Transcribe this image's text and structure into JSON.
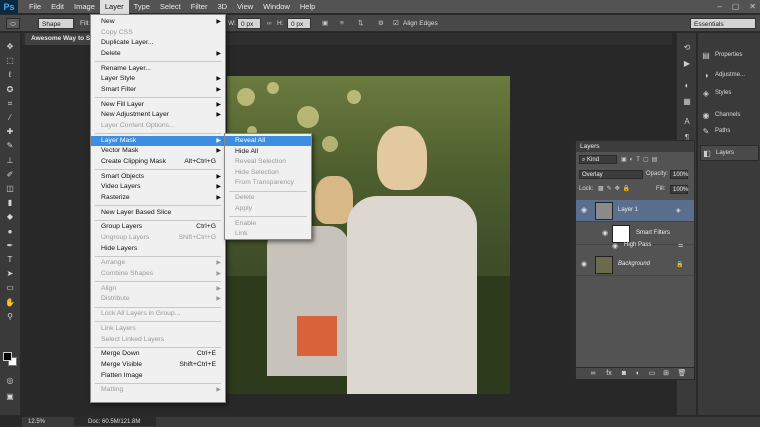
{
  "app": {
    "logo": "Ps",
    "window_controls": [
      "–",
      "▢",
      "✕"
    ]
  },
  "menubar": {
    "items": [
      "File",
      "Edit",
      "Image",
      "Layer",
      "Type",
      "Select",
      "Filter",
      "3D",
      "View",
      "Window",
      "Help"
    ],
    "active": "Layer"
  },
  "options": {
    "shape_label": "Shape",
    "fill_label": "Fill:",
    "w_label": "W:",
    "w_value": "0 px",
    "h_label": "H:",
    "h_value": "0 px",
    "align_edges": "Align Edges",
    "workspace": "Essentials"
  },
  "document": {
    "tab_title": "Awesome Way to Sh"
  },
  "status": {
    "zoom": "12.5%",
    "doc_size": "Doc: 60.5M/121.8M"
  },
  "layer_menu": {
    "items": [
      {
        "label": "New",
        "arrow": true
      },
      {
        "label": "Copy CSS",
        "disabled": true
      },
      {
        "label": "Duplicate Layer..."
      },
      {
        "label": "Delete",
        "arrow": true
      },
      {
        "label": "Rename Layer..."
      },
      {
        "label": "Layer Style",
        "arrow": true
      },
      {
        "label": "Smart Filter",
        "arrow": true
      },
      {
        "label": "New Fill Layer",
        "arrow": true
      },
      {
        "label": "New Adjustment Layer",
        "arrow": true
      },
      {
        "label": "Layer Content Options...",
        "disabled": true
      },
      {
        "label": "Layer Mask",
        "arrow": true,
        "highlight": true
      },
      {
        "label": "Vector Mask",
        "arrow": true
      },
      {
        "label": "Create Clipping Mask",
        "shortcut": "Alt+Ctrl+G"
      },
      {
        "label": "Smart Objects",
        "arrow": true
      },
      {
        "label": "Video Layers",
        "arrow": true
      },
      {
        "label": "Rasterize",
        "arrow": true
      },
      {
        "label": "New Layer Based Slice"
      },
      {
        "label": "Group Layers",
        "shortcut": "Ctrl+G"
      },
      {
        "label": "Ungroup Layers",
        "shortcut": "Shift+Ctrl+G",
        "disabled": true
      },
      {
        "label": "Hide Layers"
      },
      {
        "label": "Arrange",
        "arrow": true,
        "disabled": true
      },
      {
        "label": "Combine Shapes",
        "arrow": true,
        "disabled": true
      },
      {
        "label": "Align",
        "arrow": true,
        "disabled": true
      },
      {
        "label": "Distribute",
        "arrow": true,
        "disabled": true
      },
      {
        "label": "Lock All Layers in Group...",
        "disabled": true
      },
      {
        "label": "Link Layers",
        "disabled": true
      },
      {
        "label": "Select Linked Layers",
        "disabled": true
      },
      {
        "label": "Merge Down",
        "shortcut": "Ctrl+E"
      },
      {
        "label": "Merge Visible",
        "shortcut": "Shift+Ctrl+E"
      },
      {
        "label": "Flatten Image"
      },
      {
        "label": "Matting",
        "arrow": true,
        "disabled": true
      }
    ]
  },
  "mask_submenu": {
    "items": [
      {
        "label": "Reveal All",
        "highlight": true
      },
      {
        "label": "Hide All"
      },
      {
        "label": "Reveal Selection",
        "disabled": true
      },
      {
        "label": "Hide Selection",
        "disabled": true
      },
      {
        "label": "From Transparency",
        "disabled": true
      },
      {
        "label": "Delete",
        "disabled": true
      },
      {
        "label": "Apply",
        "disabled": true
      },
      {
        "label": "Enable",
        "disabled": true
      },
      {
        "label": "Link",
        "disabled": true
      }
    ]
  },
  "dock": {
    "items": [
      "Properties",
      "Adjustme...",
      "Styles",
      "Channels",
      "Paths",
      "Layers"
    ]
  },
  "layers_panel": {
    "title": "Layers",
    "kind": "Kind",
    "blend_mode": "Overlay",
    "opacity_label": "Opacity:",
    "opacity": "100%",
    "lock_label": "Lock:",
    "fill_label": "Fill:",
    "fill": "100%",
    "layers": {
      "layer1": "Layer 1",
      "smart_filters": "Smart Filters",
      "high_pass": "High Pass",
      "background": "Background"
    }
  }
}
